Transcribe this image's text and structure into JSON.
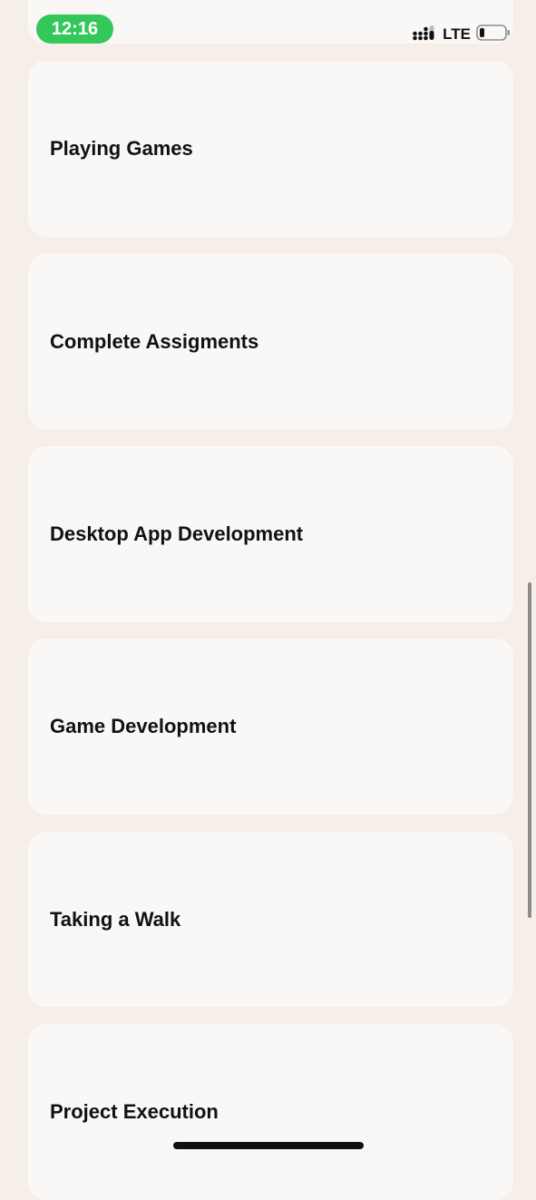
{
  "status_bar": {
    "time": "12:16",
    "network": "LTE",
    "signal_icon": "signal-bars-icon",
    "battery_icon": "battery-low-icon",
    "time_badge_color": "#34c759"
  },
  "cards": [
    {
      "label": "Playing Games"
    },
    {
      "label": "Complete Assigments"
    },
    {
      "label": "Desktop App Development"
    },
    {
      "label": "Game Development"
    },
    {
      "label": "Taking a Walk"
    },
    {
      "label": "Project Execution"
    }
  ],
  "colors": {
    "background": "#f6efe9",
    "card": "#faf8f6",
    "text": "#111111"
  }
}
